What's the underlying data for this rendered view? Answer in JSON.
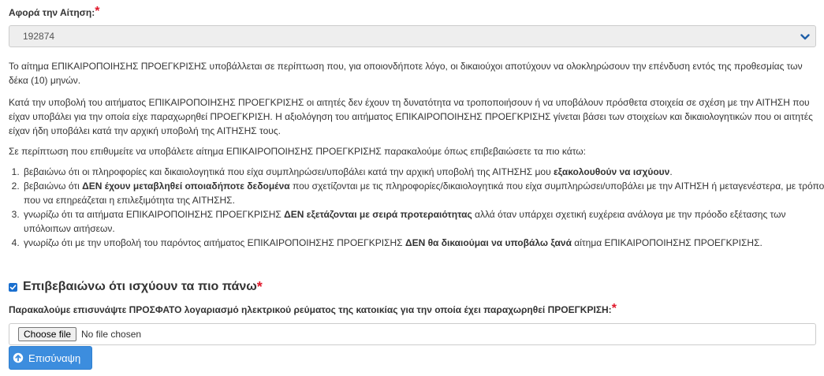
{
  "application": {
    "label": "Αφορά την Αίτηση:",
    "required_mark": "*",
    "selected_value": "192874"
  },
  "info": {
    "p1": "Το αίτημα ΕΠΙΚΑΙΡΟΠΟΙΗΣΗΣ ΠΡΟΕΓΚΡΙΣΗΣ υποβάλλεται σε περίπτωση που, για οποιονδήποτε λόγο, οι δικαιούχοι αποτύχουν να ολοκληρώσουν την επένδυση εντός της προθεσμίας των δέκα (10) μηνών.",
    "p2": "Κατά την υποβολή του αιτήματος ΕΠΙΚΑΙΡΟΠΟΙΗΣΗΣ ΠΡΟΕΓΚΡΙΣΗΣ οι αιτητές δεν έχουν τη δυνατότητα να τροποποιήσουν ή να υποβάλουν πρόσθετα στοιχεία σε σχέση με την ΑΙΤΗΣΗ που είχαν υποβάλει για την οποία είχε παραχωρηθεί ΠΡΟΕΓΚΡΙΣΗ. Η αξιολόγηση του αιτήματος ΕΠΙΚΑΙΡΟΠΟΙΗΣΗΣ ΠΡΟΕΓΚΡΙΣΗΣ γίνεται βάσει των στοιχείων και δικαιολογητικών που οι αιτητές είχαν ήδη υποβάλει κατά την αρχική υποβολή της ΑΙΤΗΣΗΣ τους.",
    "p3": "Σε περίπτωση που επιθυμείτε να υποβάλετε αίτημα ΕΠΙΚΑΙΡΟΠΟΙΗΣΗΣ ΠΡΟΕΓΚΡΙΣΗΣ παρακαλούμε όπως επιβεβαιώσετε τα πιο κάτω:"
  },
  "conditions": [
    {
      "a": "βεβαιώνω ότι οι πληροφορίες και δικαιολογητικά που είχα συμπληρώσει/υποβάλει κατά την αρχική υποβολή της ΑΙΤΗΣΗΣ μου ",
      "b": "εξακολουθούν να ισχύουν",
      "c": "."
    },
    {
      "a": "βεβαιώνω ότι ",
      "b": "ΔΕΝ έχουν μεταβληθεί οποιαδήποτε δεδομένα",
      "c": " που σχετίζονται με τις πληροφορίες/δικαιολογητικά που είχα συμπληρώσει/υποβάλει με την ΑΙΤΗΣΗ ή μεταγενέστερα, με τρόπο που να επηρεάζεται η επιλεξιμότητα της ΑΙΤΗΣΗΣ."
    },
    {
      "a": "γνωρίζω ότι τα αιτήματα ΕΠΙΚΑΙΡΟΠΟΙΗΣΗΣ ΠΡΟΕΓΚΡΙΣΗΣ ",
      "b": "ΔΕΝ εξετάζονται με σειρά προτεραιότητας",
      "c": " αλλά όταν υπάρχει σχετική ευχέρεια ανάλογα με την πρόοδο εξέτασης των υπόλοιπων αιτήσεων."
    },
    {
      "a": "γνωρίζω ότι με την υποβολή του παρόντος αιτήματος ΕΠΙΚΑΙΡΟΠΟΙΗΣΗΣ ΠΡΟΕΓΚΡΙΣΗΣ ",
      "b": "ΔΕΝ θα δικαιούμαι να υποβάλω ξανά",
      "c": " αίτημα ΕΠΙΚΑΙΡΟΠΟΙΗΣΗΣ ΠΡΟΕΓΚΡΙΣΗΣ."
    }
  ],
  "confirm": {
    "label": "Επιβεβαιώνω ότι ισχύουν τα πιο πάνω",
    "required_mark": "*",
    "checked": true
  },
  "upload": {
    "label": "Παρακαλούμε επισυνάψτε ΠΡΟΣΦΑΤΟ λογαριασμό ηλεκτρικού ρεύματος της κατοικίας για την οποία έχει παραχωρηθεί ΠΡΟΕΓΚΡΙΣΗ:",
    "required_mark": "*",
    "choose_label": "Choose file",
    "status": "No file chosen",
    "attach_label": "Επισύναψη"
  },
  "colors": {
    "required": "#e0182b",
    "primary_button": "#3c8dde",
    "checkbox": "#1a6fcf"
  }
}
